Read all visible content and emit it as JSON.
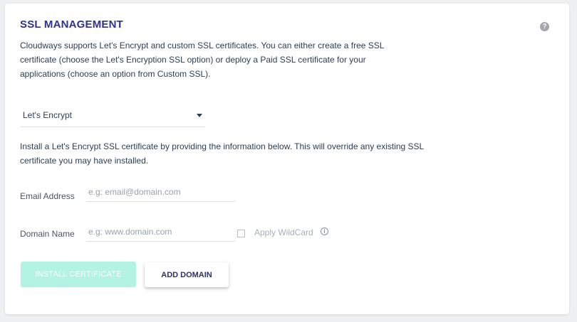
{
  "section": {
    "title": "SSL MANAGEMENT",
    "help_icon": "question-circle-icon",
    "help_glyph": "?",
    "description": "Cloudways supports Let's Encrypt and custom SSL certificates. You can either create a free SSL certificate (choose the Let's Encryption SSL option) or deploy a Paid SSL certificate for your applications (choose an option from Custom SSL)."
  },
  "ssl_type_select": {
    "selected": "Let's Encrypt",
    "icon": "caret-down-icon"
  },
  "install_note": "Install a Let's Encrypt SSL certificate by providing the information below. This will override any existing SSL certificate you may have installed.",
  "form": {
    "email": {
      "label": "Email Address",
      "value": "",
      "placeholder": "e.g: email@domain.com"
    },
    "domain": {
      "label": "Domain Name",
      "value": "",
      "placeholder": "e.g: www.domain.com"
    },
    "wildcard": {
      "label": "Apply WildCard",
      "checked": false,
      "info_icon": "info-circle-icon",
      "info_glyph": "i"
    }
  },
  "actions": {
    "install_label": "INSTALL CERTIFICATE",
    "add_domain_label": "ADD DOMAIN"
  },
  "colors": {
    "title": "#2e3191",
    "install_button_bg": "#b3f3e4",
    "text": "#2c3e50"
  }
}
